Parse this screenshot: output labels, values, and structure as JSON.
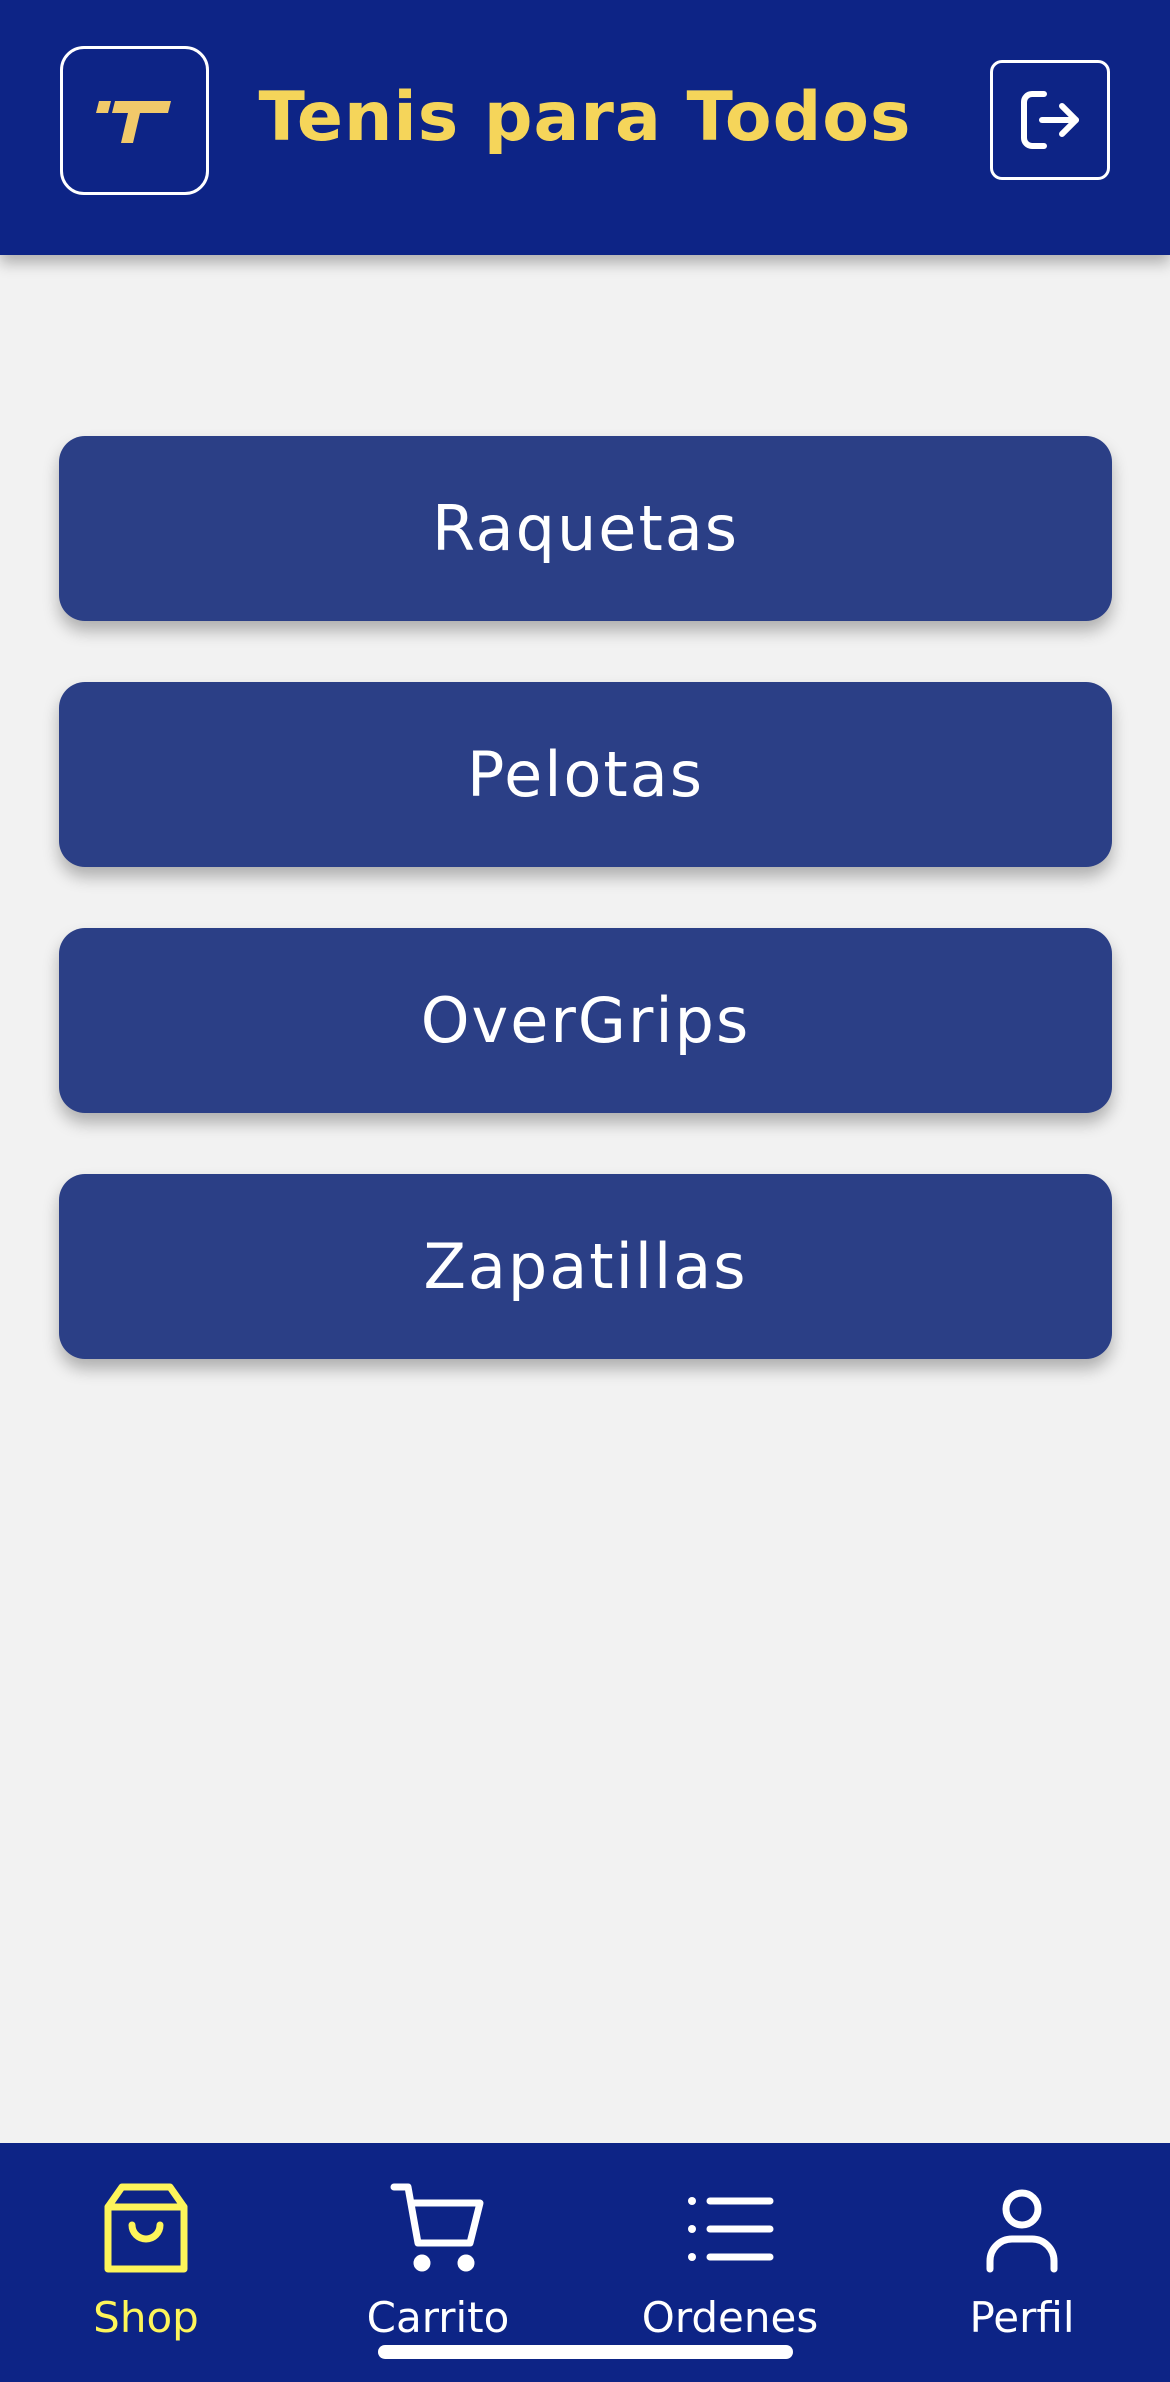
{
  "header": {
    "title": "Tenis para Todos",
    "logo_icon": "brand-t-logo-icon",
    "logout_icon": "logout-icon",
    "title_color": "#f5d55a",
    "bg_color": "#0d2486"
  },
  "categories": [
    {
      "label": "Raquetas"
    },
    {
      "label": "Pelotas"
    },
    {
      "label": "OverGrips"
    },
    {
      "label": "Zapatillas"
    }
  ],
  "tabbar": {
    "active_color": "#fdf55a",
    "items": [
      {
        "label": "Shop",
        "icon": "shopping-bag-icon",
        "active": true
      },
      {
        "label": "Carrito",
        "icon": "cart-icon",
        "active": false
      },
      {
        "label": "Ordenes",
        "icon": "list-icon",
        "active": false
      },
      {
        "label": "Perfil",
        "icon": "user-icon",
        "active": false
      }
    ]
  }
}
